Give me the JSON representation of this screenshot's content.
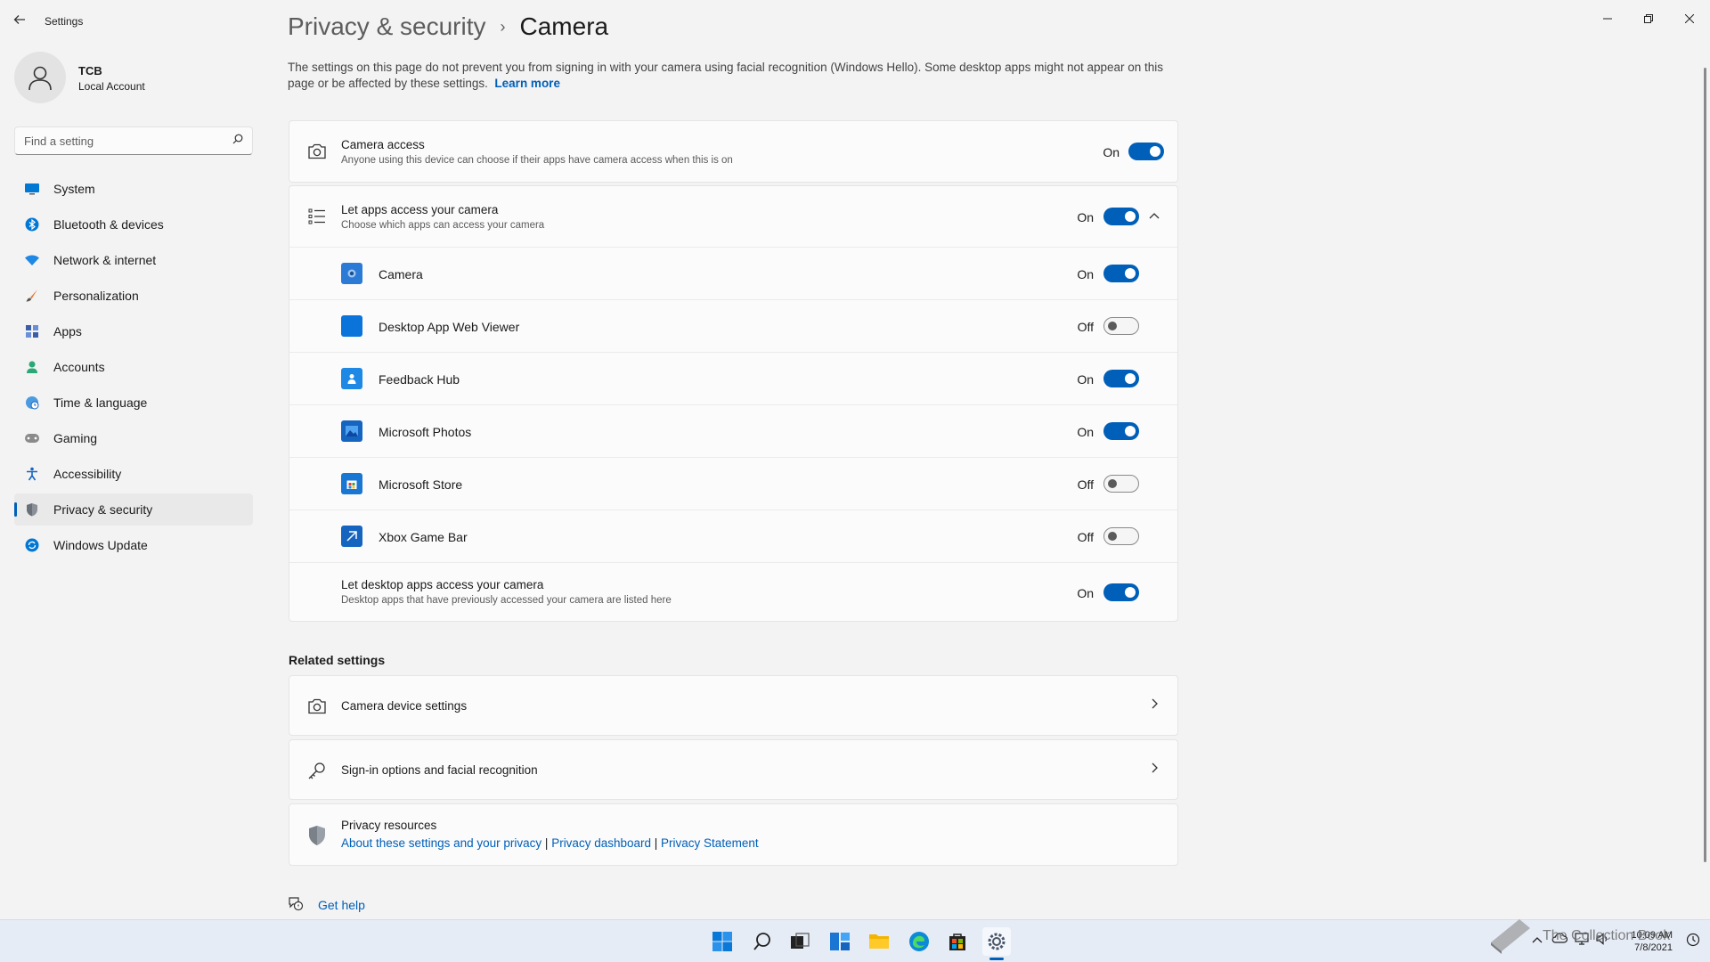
{
  "window": {
    "title": "Settings",
    "back_icon": "back-arrow-icon"
  },
  "profile": {
    "name": "TCB",
    "account_type": "Local Account"
  },
  "search": {
    "placeholder": "Find a setting"
  },
  "sidebar": {
    "items": [
      {
        "label": "System",
        "icon": "monitor-icon",
        "active": false
      },
      {
        "label": "Bluetooth & devices",
        "icon": "bluetooth-icon",
        "active": false
      },
      {
        "label": "Network & internet",
        "icon": "wifi-icon",
        "active": false
      },
      {
        "label": "Personalization",
        "icon": "brush-icon",
        "active": false
      },
      {
        "label": "Apps",
        "icon": "apps-icon",
        "active": false
      },
      {
        "label": "Accounts",
        "icon": "person-icon",
        "active": false
      },
      {
        "label": "Time & language",
        "icon": "globe-clock-icon",
        "active": false
      },
      {
        "label": "Gaming",
        "icon": "gamepad-icon",
        "active": false
      },
      {
        "label": "Accessibility",
        "icon": "accessibility-icon",
        "active": false
      },
      {
        "label": "Privacy & security",
        "icon": "shield-icon",
        "active": true
      },
      {
        "label": "Windows Update",
        "icon": "update-icon",
        "active": false
      }
    ]
  },
  "breadcrumb": {
    "parent": "Privacy & security",
    "separator": "›",
    "current": "Camera"
  },
  "intro": {
    "text": "The settings on this page do not prevent you from signing in with your camera using facial recognition (Windows Hello). Some desktop apps might not appear on this page or be affected by these settings.",
    "link": "Learn more"
  },
  "camera_access": {
    "title": "Camera access",
    "subtitle": "Anyone using this device can choose if their apps have camera access when this is on",
    "state": "On"
  },
  "apps_access": {
    "title": "Let apps access your camera",
    "subtitle": "Choose which apps can access your camera",
    "state": "On",
    "apps": [
      {
        "name": "Camera",
        "state": "On",
        "icon": "camera-app-icon",
        "color": "#2b7bd6"
      },
      {
        "name": "Desktop App Web Viewer",
        "state": "Off",
        "icon": "web-viewer-app-icon",
        "color": "#0a74da"
      },
      {
        "name": "Feedback Hub",
        "state": "On",
        "icon": "feedback-hub-app-icon",
        "color": "#1e88e5"
      },
      {
        "name": "Microsoft Photos",
        "state": "On",
        "icon": "photos-app-icon",
        "color": "#1565c0"
      },
      {
        "name": "Microsoft Store",
        "state": "Off",
        "icon": "store-app-icon",
        "color": "#1976d2"
      },
      {
        "name": "Xbox Game Bar",
        "state": "Off",
        "icon": "xbox-game-bar-app-icon",
        "color": "#1565c0"
      }
    ]
  },
  "desktop_apps": {
    "title": "Let desktop apps access your camera",
    "subtitle": "Desktop apps that have previously accessed your camera are listed here",
    "state": "On"
  },
  "related": {
    "heading": "Related settings",
    "items": [
      {
        "label": "Camera device settings",
        "icon": "camera-icon"
      },
      {
        "label": "Sign-in options and facial recognition",
        "icon": "key-icon"
      }
    ]
  },
  "privacy_resources": {
    "title": "Privacy resources",
    "links": [
      "About these settings and your privacy",
      "Privacy dashboard",
      "Privacy Statement"
    ],
    "separator": "|"
  },
  "help": {
    "label": "Get help"
  },
  "taskbar": {
    "icons": [
      "windows-start-icon",
      "search-icon",
      "task-view-icon",
      "widgets-icon",
      "file-explorer-icon",
      "edge-icon",
      "store-icon",
      "settings-icon"
    ],
    "active": "settings-icon"
  },
  "tray": {
    "time": "10:09 AM",
    "date": "7/8/2021",
    "watermark": "The Collection Book"
  },
  "colors": {
    "accent": "#005fb8",
    "background": "#f3f3f3",
    "card": "#fbfbfb"
  }
}
